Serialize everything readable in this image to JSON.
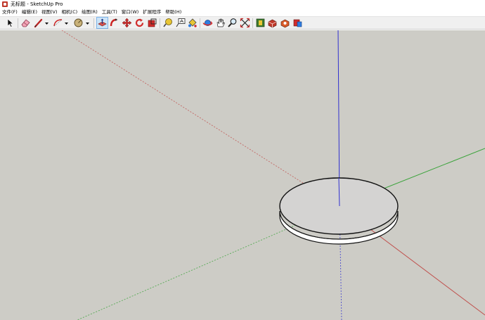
{
  "window": {
    "title": "无标题 - SketchUp Pro",
    "app_icon": "sketchup-logo-icon"
  },
  "menu": {
    "items": [
      {
        "label": "文件(F)"
      },
      {
        "label": "编辑(E)"
      },
      {
        "label": "视图(V)"
      },
      {
        "label": "相机(C)"
      },
      {
        "label": "绘图(R)"
      },
      {
        "label": "工具(T)"
      },
      {
        "label": "窗口(W)"
      },
      {
        "label": "扩展程序"
      },
      {
        "label": "帮助(H)"
      }
    ]
  },
  "toolbar": {
    "tools": [
      {
        "name": "select-icon"
      },
      {
        "name": "eraser-icon"
      },
      {
        "name": "line-pencil-icon"
      },
      {
        "name": "arc-icon"
      },
      {
        "name": "shapes-icon"
      },
      {
        "name": "push-pull-icon"
      },
      {
        "name": "follow-me-icon"
      },
      {
        "name": "move-icon"
      },
      {
        "name": "rotate-icon"
      },
      {
        "name": "scale-icon"
      },
      {
        "name": "tape-measure-icon"
      },
      {
        "name": "text-label-icon"
      },
      {
        "name": "paint-bucket-icon"
      },
      {
        "name": "orbit-icon"
      },
      {
        "name": "pan-icon"
      },
      {
        "name": "zoom-icon"
      },
      {
        "name": "zoom-extents-icon"
      },
      {
        "name": "3d-warehouse-icon"
      },
      {
        "name": "extension-warehouse-icon"
      },
      {
        "name": "layout-icon"
      },
      {
        "name": "extension-manager-icon"
      }
    ],
    "active_tool": "push-pull-icon"
  },
  "viewport": {
    "background_color": "#cdccc6",
    "axis_colors": {
      "red": "#c0504d",
      "green": "#3aa33a",
      "blue": "#3030d0"
    },
    "model": "disc"
  }
}
